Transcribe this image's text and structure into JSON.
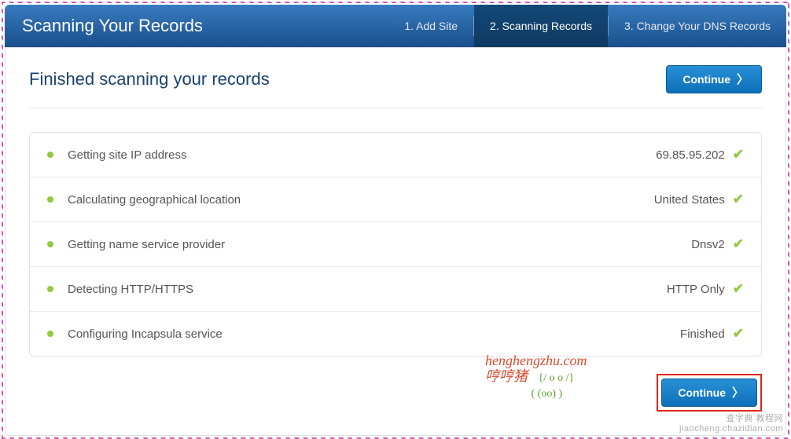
{
  "header": {
    "title": "Scanning Your Records",
    "steps": [
      {
        "label": "1. Add Site"
      },
      {
        "label": "2. Scanning Records"
      },
      {
        "label": "3. Change Your DNS Records"
      }
    ]
  },
  "page": {
    "title": "Finished scanning your records",
    "continue_label": "Continue"
  },
  "scan_rows": [
    {
      "label": "Getting site IP address",
      "value": "69.85.95.202"
    },
    {
      "label": "Calculating geographical location",
      "value": "United States"
    },
    {
      "label": "Getting name service provider",
      "value": "Dnsv2"
    },
    {
      "label": "Detecting HTTP/HTTPS",
      "value": "HTTP Only"
    },
    {
      "label": "Configuring Incapsula service",
      "value": "Finished"
    }
  ],
  "watermark": {
    "line1": "henghengzhu.com",
    "line2_a": "哼哼猪",
    "line2_b": "{/ o o /}",
    "line2_c": "( (oo) )"
  },
  "footer": {
    "continue_label": "Continue",
    "corner1": "查字典  教程网",
    "corner2": "jiaocheng.chazidian.com"
  }
}
